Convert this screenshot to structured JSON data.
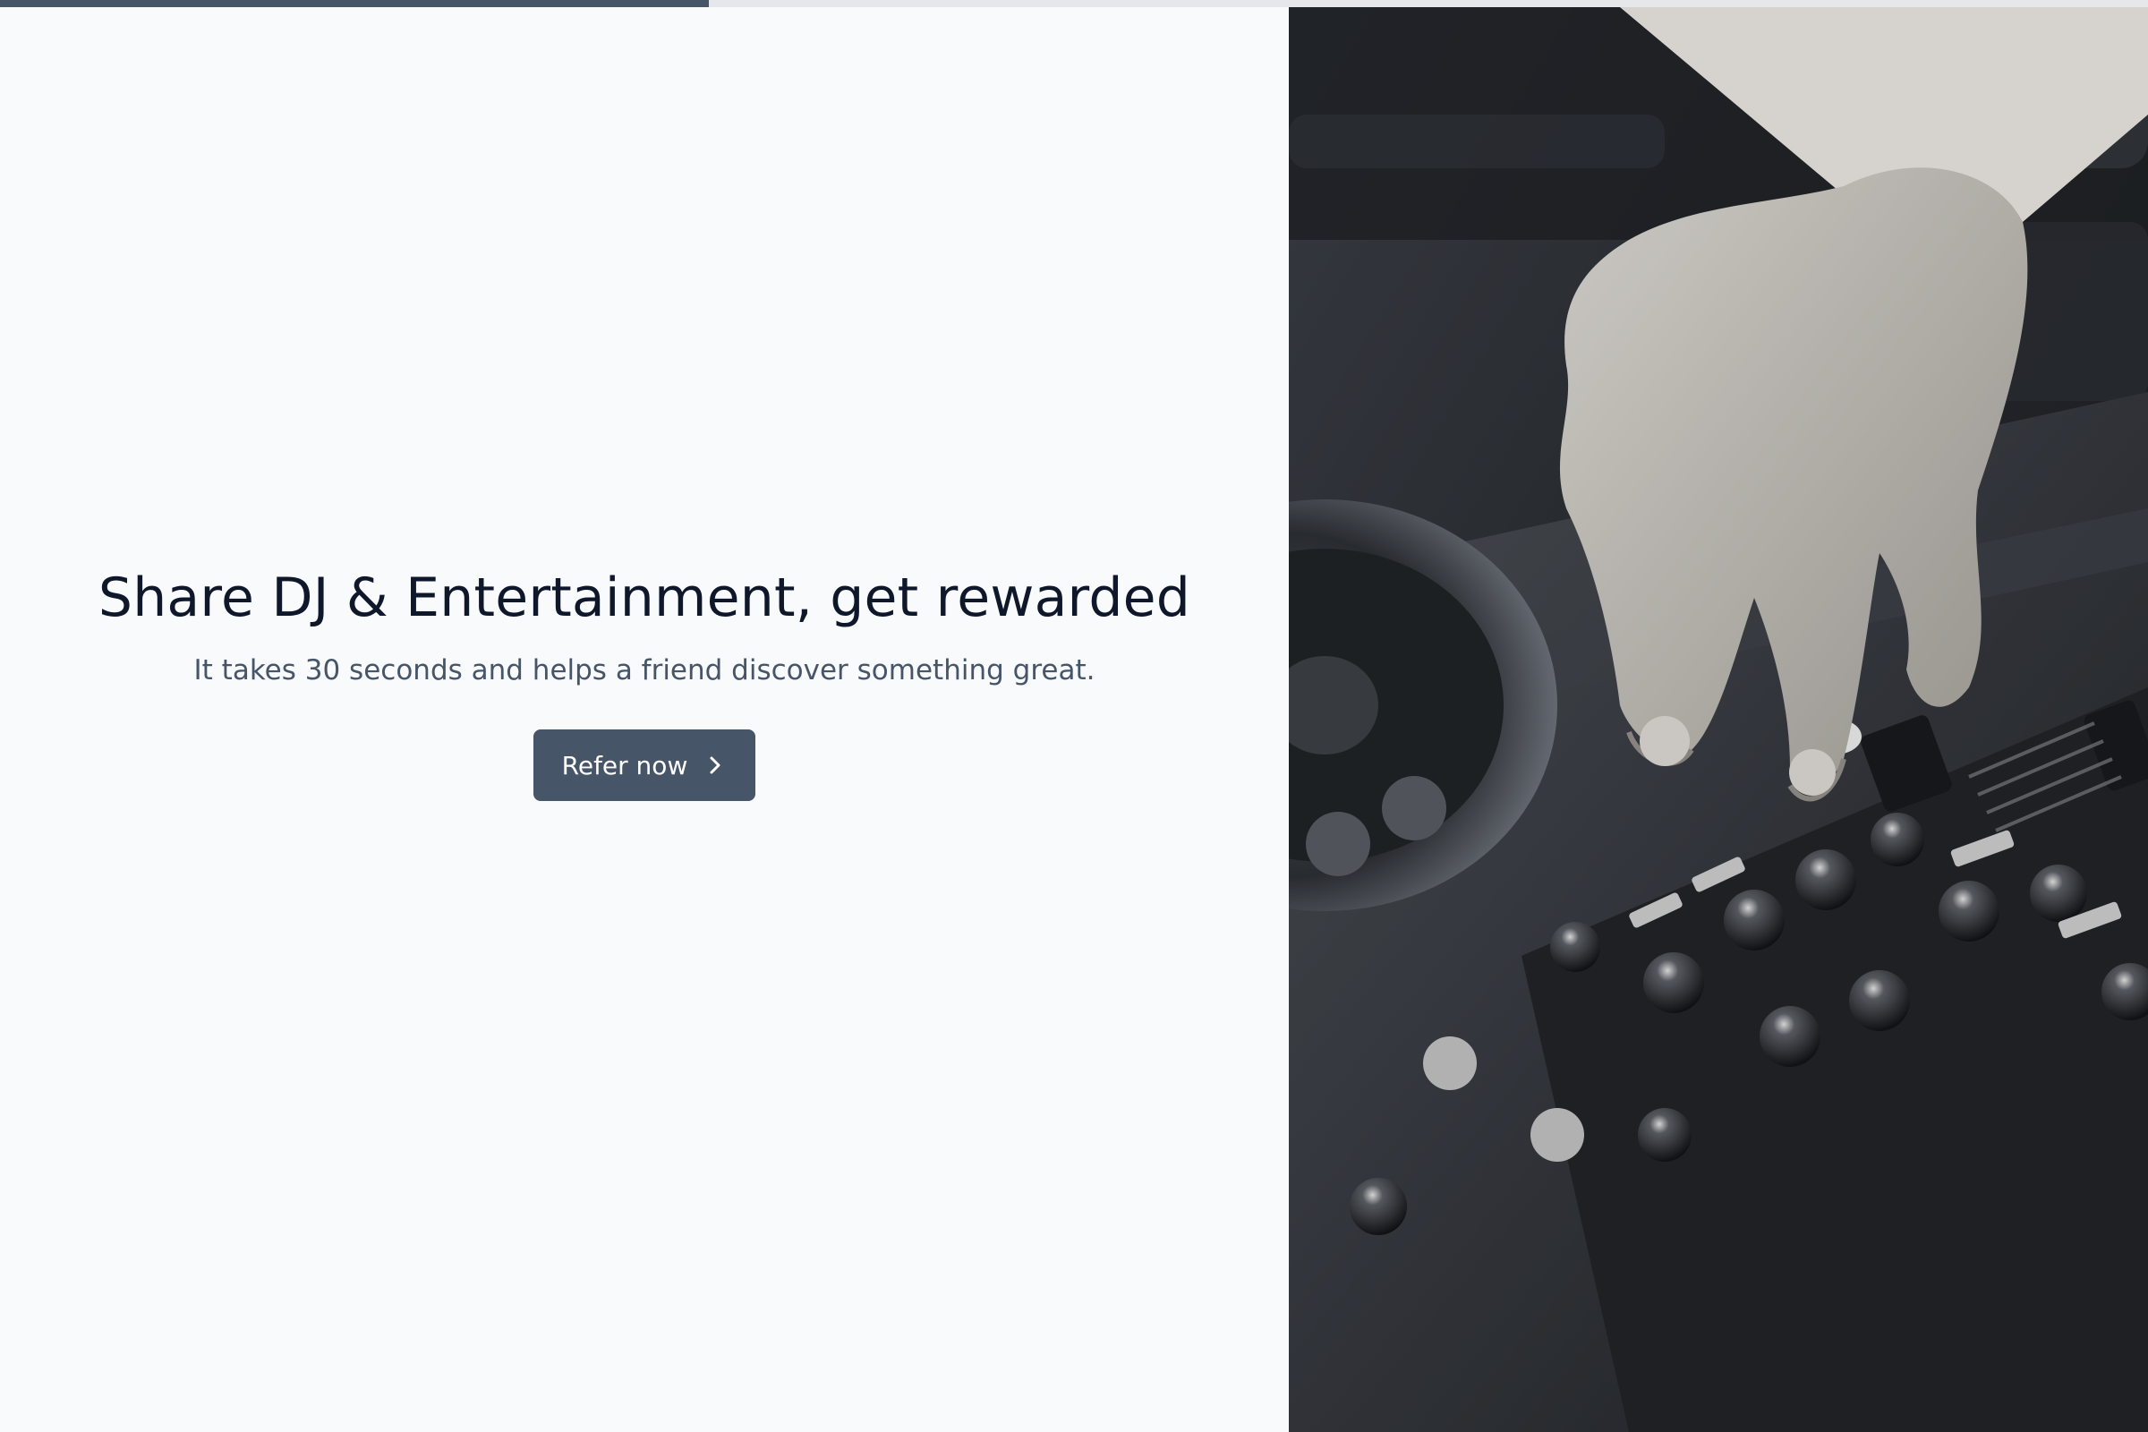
{
  "progress": {
    "fraction": 0.33
  },
  "hero": {
    "headline": "Share DJ & Entertainment, get rewarded",
    "subtext": "It takes 30 seconds and helps a friend discover something great.",
    "cta_label": "Refer now",
    "cta_icon": "chevron-right-icon"
  },
  "photo": {
    "subject": "dj-mixer-controller-image"
  },
  "colors": {
    "background": "#f8fafc",
    "accent": "#475569",
    "headline": "#0f172a",
    "subtext": "#475569",
    "progress_track": "#e5e7eb"
  }
}
